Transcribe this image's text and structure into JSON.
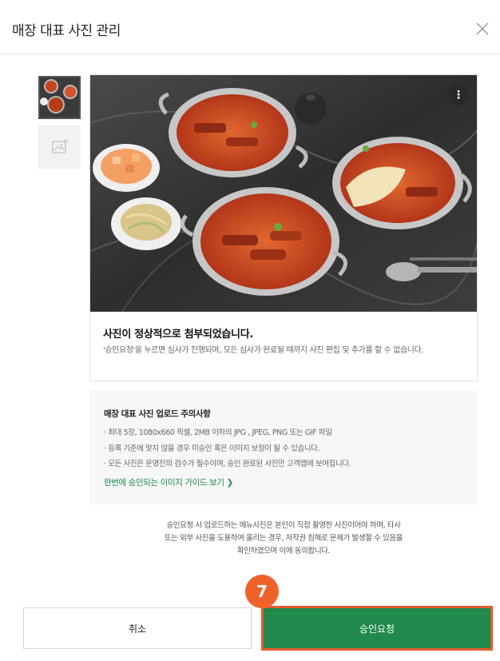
{
  "header": {
    "title": "매장 대표 사진 관리",
    "close_icon": "close-icon"
  },
  "thumbnails": {
    "selected_icon": "food-photo-thumbnail",
    "add_icon": "add-image-icon"
  },
  "photo_card": {
    "more_icon": "vertical-dots-icon",
    "message_title": "사진이 정상적으로 첨부되었습니다.",
    "message_body": "'승인요청'을 누르면 심사가 진행되며, 모든 심사가 완료될 때까지 사진 편집 및 추가를 할 수 없습니다."
  },
  "notice": {
    "title": "매장 대표 사진 업로드 주의사항",
    "items": [
      "· 최대 5장, 1080x660 픽셀, 2MB 이하의 JPG , JPEG, PNG 또는 GIF 파일",
      "· 등록 기준에 맞지 않을 경우 미승인 혹은 이미지 보정이 될 수 있습니다.",
      "· 모든 사진은 운영진의 검수가 필수이며, 승인 완료된 사진만 고객앱에 보여집니다."
    ],
    "guide_link": "한번에 승인되는 이미지 가이드 보기 ❯"
  },
  "agreement": {
    "lines": [
      "승인요청 시 업로드하는 메뉴사진은 본인이 직접 촬영한 사진이어야 하며, 타사",
      "또는 외부 사진을 도용하여 올리는 경우, 저작권 침해로 문제가 발생할 수 있음을",
      "확인하였으며 이에 동의합니다."
    ]
  },
  "buttons": {
    "cancel": "취소",
    "approve": "승인요청"
  },
  "step_badge": "7",
  "colors": {
    "primary_green": "#1f8a4c",
    "highlight_orange": "#ee6229",
    "link_green": "#1f8a49"
  }
}
